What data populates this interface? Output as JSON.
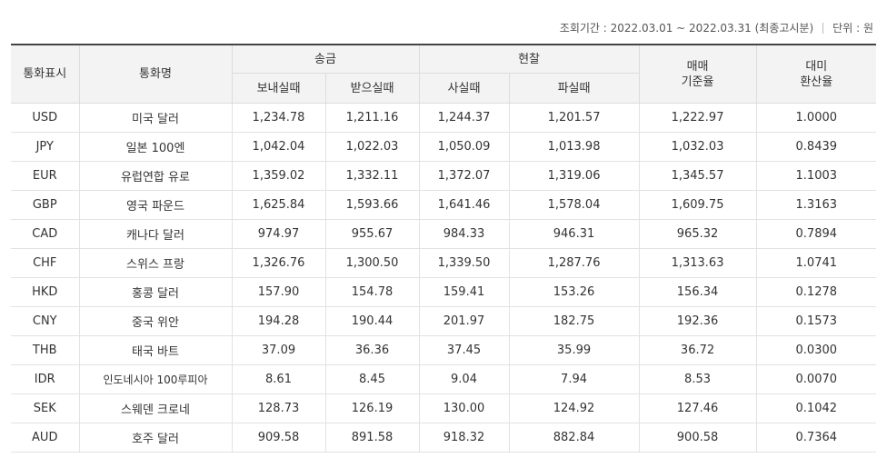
{
  "period": {
    "label": "조회기간 :",
    "range": "2022.03.01 ~ 2022.03.31",
    "note": "(최종고시분)",
    "unit_label": "단위 :",
    "unit_value": "원"
  },
  "table": {
    "headers": {
      "code": "통화표시",
      "name": "통화명",
      "remit": "송금",
      "remit_send": "보내실때",
      "remit_receive": "받으실때",
      "cash": "현찰",
      "cash_buy": "사실때",
      "cash_sell": "파실때",
      "base_rate_line1": "매매",
      "base_rate_line2": "기준율",
      "usd_rate_line1": "대미",
      "usd_rate_line2": "환산율"
    },
    "rows": [
      {
        "code": "USD",
        "name": "미국 달러",
        "send": "1,234.78",
        "receive": "1,211.16",
        "buy": "1,244.37",
        "sell": "1,201.57",
        "base": "1,222.97",
        "usd": "1.0000"
      },
      {
        "code": "JPY",
        "name": "일본 100엔",
        "send": "1,042.04",
        "receive": "1,022.03",
        "buy": "1,050.09",
        "sell": "1,013.98",
        "base": "1,032.03",
        "usd": "0.8439"
      },
      {
        "code": "EUR",
        "name": "유럽연합 유로",
        "send": "1,359.02",
        "receive": "1,332.11",
        "buy": "1,372.07",
        "sell": "1,319.06",
        "base": "1,345.57",
        "usd": "1.1003"
      },
      {
        "code": "GBP",
        "name": "영국 파운드",
        "send": "1,625.84",
        "receive": "1,593.66",
        "buy": "1,641.46",
        "sell": "1,578.04",
        "base": "1,609.75",
        "usd": "1.3163"
      },
      {
        "code": "CAD",
        "name": "캐나다 달러",
        "send": "974.97",
        "receive": "955.67",
        "buy": "984.33",
        "sell": "946.31",
        "base": "965.32",
        "usd": "0.7894"
      },
      {
        "code": "CHF",
        "name": "스위스 프랑",
        "send": "1,326.76",
        "receive": "1,300.50",
        "buy": "1,339.50",
        "sell": "1,287.76",
        "base": "1,313.63",
        "usd": "1.0741"
      },
      {
        "code": "HKD",
        "name": "홍콩 달러",
        "send": "157.90",
        "receive": "154.78",
        "buy": "159.41",
        "sell": "153.26",
        "base": "156.34",
        "usd": "0.1278"
      },
      {
        "code": "CNY",
        "name": "중국 위안",
        "send": "194.28",
        "receive": "190.44",
        "buy": "201.97",
        "sell": "182.75",
        "base": "192.36",
        "usd": "0.1573"
      },
      {
        "code": "THB",
        "name": "태국 바트",
        "send": "37.09",
        "receive": "36.36",
        "buy": "37.45",
        "sell": "35.99",
        "base": "36.72",
        "usd": "0.0300"
      },
      {
        "code": "IDR",
        "name": "인도네시아 100루피아",
        "send": "8.61",
        "receive": "8.45",
        "buy": "9.04",
        "sell": "7.94",
        "base": "8.53",
        "usd": "0.0070"
      },
      {
        "code": "SEK",
        "name": "스웨덴 크로네",
        "send": "128.73",
        "receive": "126.19",
        "buy": "130.00",
        "sell": "124.92",
        "base": "127.46",
        "usd": "0.1042"
      },
      {
        "code": "AUD",
        "name": "호주 달러",
        "send": "909.58",
        "receive": "891.58",
        "buy": "918.32",
        "sell": "882.84",
        "base": "900.58",
        "usd": "0.7364"
      }
    ]
  }
}
